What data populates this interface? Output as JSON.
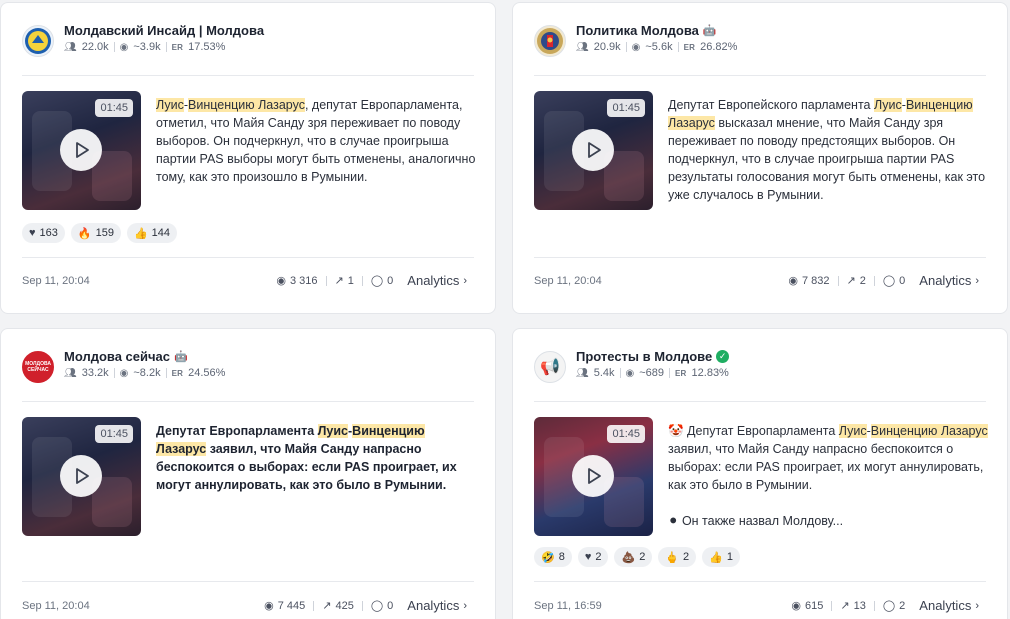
{
  "posts": [
    {
      "channel_name": "Молдавский Инсайд | Молдова",
      "badge": "",
      "subscribers": "22.0k",
      "views_avg": "~3.9k",
      "er_label": "ER",
      "er_value": "17.53%",
      "duration": "01:45",
      "text_parts": [
        "Луис",
        "-",
        "Винценцию Лазарус",
        ", депутат Европарламента, отметил, что Майя Санду зря переживает по поводу выборов. Он подчеркнул, что в случае проигрыша партии PAS выборы могут быть отменены, аналогично тому, как это произошло в Румынии."
      ],
      "reactions": [
        {
          "icon": "heart-icon",
          "glyph": "❤",
          "count": "163"
        },
        {
          "icon": "fire-icon",
          "glyph": "🔥",
          "count": "159"
        },
        {
          "icon": "thumbs-up-icon",
          "glyph": "👍",
          "count": "144"
        }
      ],
      "date": "Sep 11, 20:04",
      "views": "3 316",
      "shares": "1",
      "comments": "0",
      "analytics_label": "Analytics"
    },
    {
      "channel_name": "Политика Молдова",
      "badge": "🤖",
      "subscribers": "20.9k",
      "views_avg": "~5.6k",
      "er_label": "ER",
      "er_value": "26.82%",
      "duration": "01:45",
      "text_parts": [
        "Депутат Европейского парламента ",
        "Луис",
        "-",
        "Винценцию Лазарус",
        " высказал мнение, что Майя Санду зря переживает по поводу предстоящих выборов. Он подчеркнул, что в случае проигрыша партии PAS результаты голосования могут быть отменены, как это уже случалось в Румынии."
      ],
      "reactions": [],
      "date": "Sep 11, 20:04",
      "views": "7 832",
      "shares": "2",
      "comments": "0",
      "analytics_label": "Analytics"
    },
    {
      "channel_name": "Молдова сейчас",
      "badge": "🤖",
      "subscribers": "33.2k",
      "views_avg": "~8.2k",
      "er_label": "ER",
      "er_value": "24.56%",
      "duration": "01:45",
      "text_parts": [
        "Депутат Европарламента ",
        "Луис",
        "-",
        "Винценцию Лазарус",
        " заявил, что Майя Санду напрасно беспокоится о выборах: если PAS проиграет, их могут аннулировать, как это было в Румынии."
      ],
      "reactions": [],
      "date": "Sep 11, 20:04",
      "views": "7 445",
      "shares": "425",
      "comments": "0",
      "analytics_label": "Analytics",
      "avatar_text": "МОЛДОВА СЕЙЧАС"
    },
    {
      "channel_name": "Протесты в Молдове",
      "badge": "✓",
      "subscribers": "5.4k",
      "views_avg": "~689",
      "er_label": "ER",
      "er_value": "12.83%",
      "duration": "01:45",
      "text_parts": [
        "🤡 Депутат Европарламента ",
        "Луис",
        "-",
        "Винценцию Лазарус",
        " заявил, что Майя Санду напрасно беспокоится о выборах: если PAS проиграет, их могут аннулировать, как это было в Румынии."
      ],
      "text_extra": "⚫ Он также назвал Молдову...",
      "reactions": [
        {
          "icon": "grin-icon",
          "glyph": "🤣",
          "count": "8"
        },
        {
          "icon": "heart-icon",
          "glyph": "❤",
          "count": "2"
        },
        {
          "icon": "poop-icon",
          "glyph": "💩",
          "count": "2"
        },
        {
          "icon": "middle-finger-icon",
          "glyph": "🖕",
          "count": "2"
        },
        {
          "icon": "thumbs-up-icon",
          "glyph": "👍",
          "count": "1"
        }
      ],
      "date": "Sep 11, 16:59",
      "views": "615",
      "shares": "13",
      "comments": "2",
      "analytics_label": "Analytics"
    }
  ]
}
